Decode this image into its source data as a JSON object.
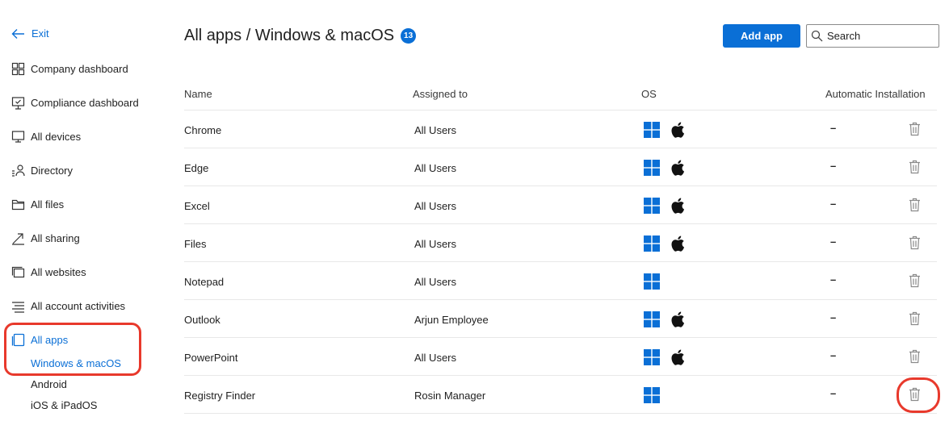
{
  "sidebar": {
    "exit_label": "Exit",
    "items": [
      {
        "label": "Company dashboard",
        "icon": "grid-icon"
      },
      {
        "label": "Compliance dashboard",
        "icon": "monitor-check-icon"
      },
      {
        "label": "All devices",
        "icon": "devices-icon"
      },
      {
        "label": "Directory",
        "icon": "directory-icon"
      },
      {
        "label": "All files",
        "icon": "folder-icon"
      },
      {
        "label": "All sharing",
        "icon": "share-icon"
      },
      {
        "label": "All websites",
        "icon": "websites-icon"
      },
      {
        "label": "All account activities",
        "icon": "list-icon"
      },
      {
        "label": "All apps",
        "icon": "apps-icon"
      }
    ],
    "sub_items": [
      "Windows & macOS",
      "Android",
      "iOS & iPadOS"
    ]
  },
  "header": {
    "title": "All apps / Windows & macOS",
    "count": "13",
    "add_button": "Add app",
    "search_placeholder": "Search"
  },
  "table": {
    "columns": [
      "Name",
      "Assigned to",
      "OS",
      "Automatic Installation"
    ],
    "rows": [
      {
        "name": "Chrome",
        "assigned": "All Users",
        "os": [
          "windows",
          "macos"
        ],
        "auto": "–"
      },
      {
        "name": "Edge",
        "assigned": "All Users",
        "os": [
          "windows",
          "macos"
        ],
        "auto": "–"
      },
      {
        "name": "Excel",
        "assigned": "All Users",
        "os": [
          "windows",
          "macos"
        ],
        "auto": "–"
      },
      {
        "name": "Files",
        "assigned": "All Users",
        "os": [
          "windows",
          "macos"
        ],
        "auto": "–"
      },
      {
        "name": "Notepad",
        "assigned": "All Users",
        "os": [
          "windows"
        ],
        "auto": "–"
      },
      {
        "name": "Outlook",
        "assigned": "Arjun Employee",
        "os": [
          "windows",
          "macos"
        ],
        "auto": "–"
      },
      {
        "name": "PowerPoint",
        "assigned": "All Users",
        "os": [
          "windows",
          "macos"
        ],
        "auto": "–"
      },
      {
        "name": "Registry Finder",
        "assigned": "Rosin Manager",
        "os": [
          "windows"
        ],
        "auto": "–"
      }
    ]
  },
  "colors": {
    "accent": "#0a6fd6",
    "highlight": "#e8392c",
    "windows": "#0a6fd6"
  }
}
